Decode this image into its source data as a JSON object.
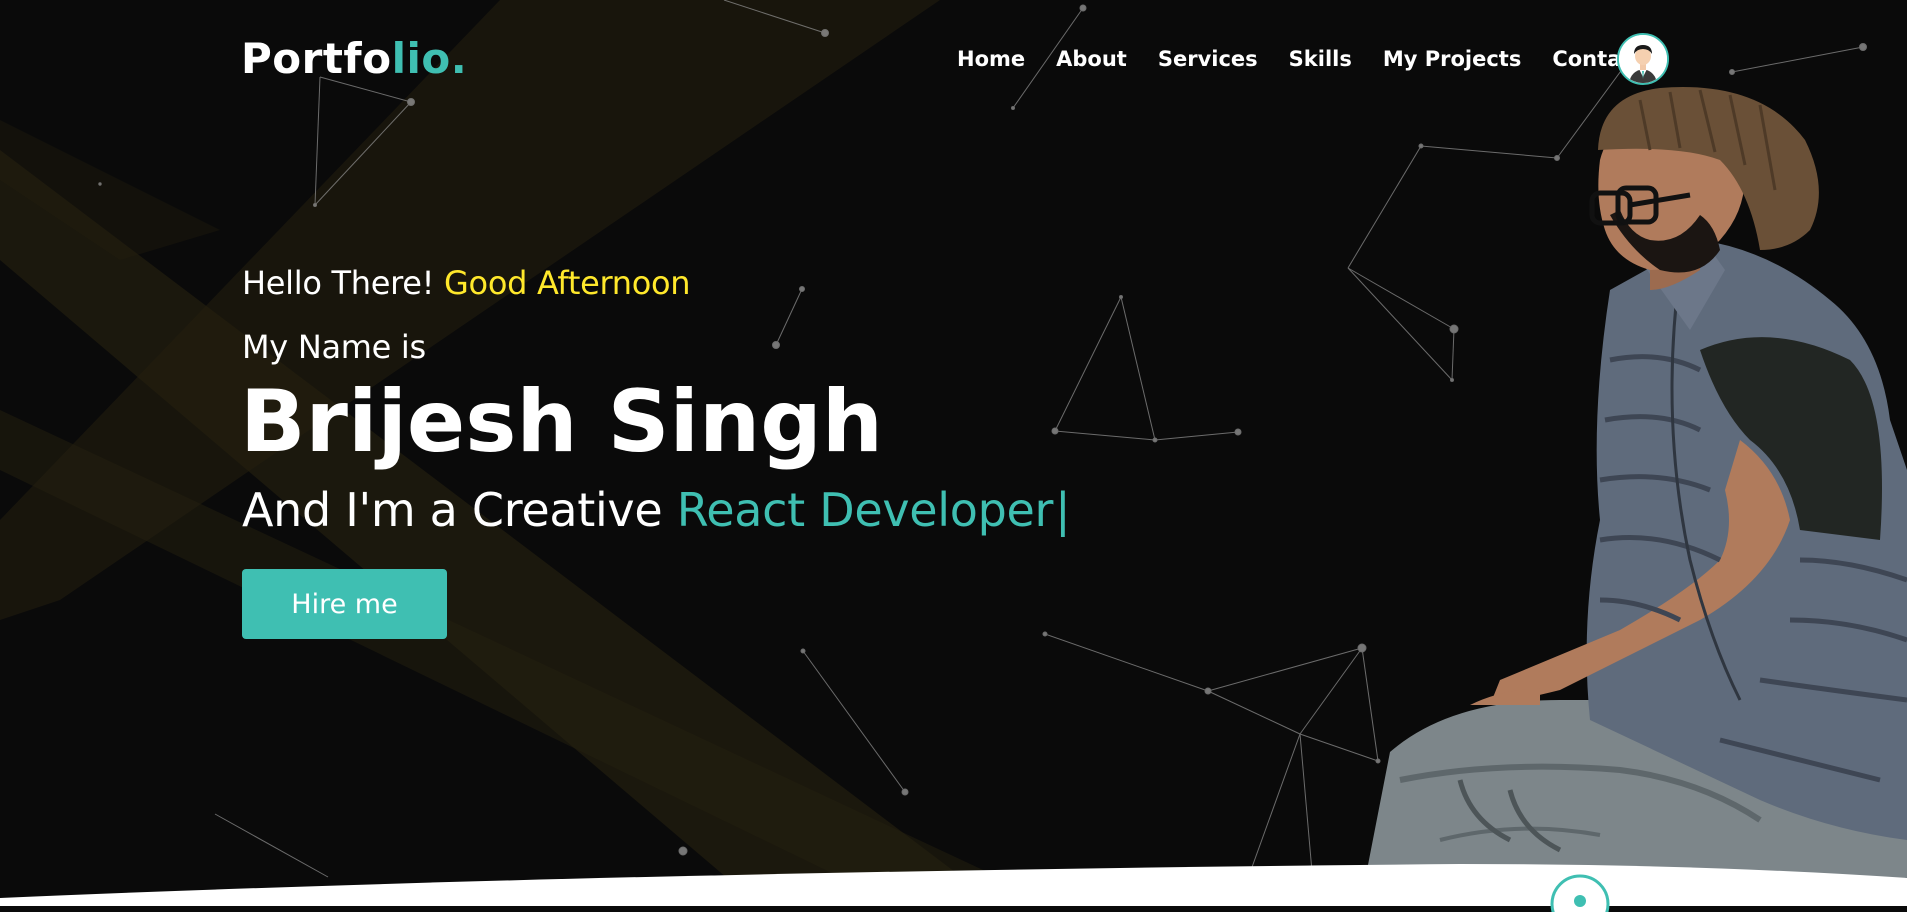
{
  "navbar": {
    "logo_main": "Portfo",
    "logo_accent": "lio.",
    "links": [
      "Home",
      "About",
      "Services",
      "Skills",
      "My Projects",
      "Contact"
    ]
  },
  "hero": {
    "greeting": "Hello There!",
    "time_of_day": "Good Afternoon",
    "intro": "My Name is",
    "name": "Brijesh Singh",
    "role_prefix": "And I'm a Creative",
    "role_typed": "React Developer",
    "caret": "|",
    "button_label": "Hire me"
  },
  "colors": {
    "background": "#0a0a0a",
    "accent": "#3fbfb2",
    "highlight": "#ffe82b",
    "text": "#ffffff"
  },
  "icons": {
    "avatar": "user-avatar-icon",
    "scroll": "scroll-down-icon"
  }
}
